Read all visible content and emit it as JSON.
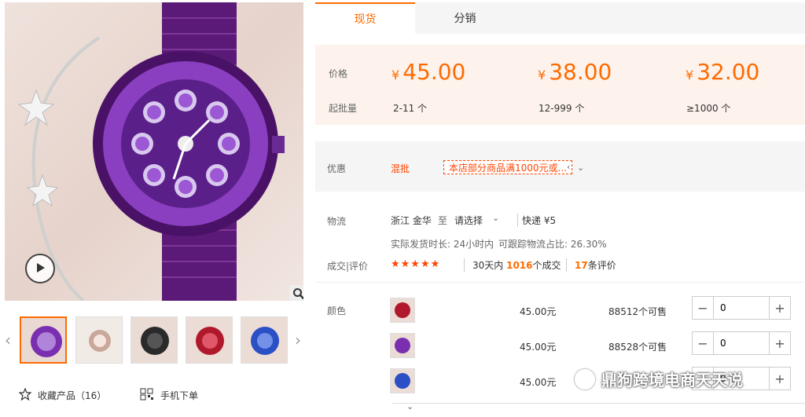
{
  "gallery": {
    "zoom_icon": "magnifier-icon",
    "play_icon": "play-icon",
    "prev_icon": "chevron-left-icon",
    "next_icon": "chevron-right-icon",
    "thumb_colors": [
      "#7a2fb0",
      "#c9a79b",
      "#2a2a2a",
      "#b0192c",
      "#2b4fc4"
    ]
  },
  "links": {
    "favorite_label": "收藏产品（16）",
    "mobile_label": "手机下单",
    "favorite_icon": "star-outline-icon",
    "mobile_icon": "qr-code-icon"
  },
  "tabs": [
    "现货",
    "分销"
  ],
  "pricing": {
    "price_label": "价格",
    "moq_label": "起批量",
    "currency": "¥",
    "tiers": [
      {
        "price": "45.00",
        "range": "2-11 个"
      },
      {
        "price": "38.00",
        "range": "12-999 个"
      },
      {
        "price": "32.00",
        "range": "≥1000 个"
      }
    ]
  },
  "promo": {
    "label": "优惠",
    "mixed": "混批",
    "tag": "本店部分商品满1000元或...",
    "tag_chevron": "chevron-left-icon",
    "expand_icon": "chevron-down-icon"
  },
  "logistics": {
    "label": "物流",
    "origin": "浙江 金华",
    "to": "至",
    "dest": "请选择",
    "shipping": "快递 ¥5",
    "dispatch": "实际发货时长: 24小时内",
    "trackable": "可跟踪物流占比: 26.30%"
  },
  "reviews": {
    "label": "成交|评价",
    "stars": "★★★★★",
    "deals_prefix": "30天内",
    "deals_count": "1016",
    "deals_suffix": "个成交",
    "review_count": "17",
    "review_suffix": "条评价"
  },
  "sku": {
    "label": "颜色",
    "items": [
      {
        "price": "45.00元",
        "stock": "88512个可售",
        "qty": "0",
        "color": "#b0192c"
      },
      {
        "price": "45.00元",
        "stock": "88528个可售",
        "qty": "0",
        "color": "#7a2fb0"
      },
      {
        "price": "45.00元",
        "stock": "",
        "qty": "0",
        "color": "#2b4fc4"
      }
    ]
  },
  "watermark": "鼎狗跨境电商天天说",
  "footer_chevron": "chevron-down-icon",
  "colors": {
    "accent": "#ff6a00",
    "promo": "#ff4400",
    "price_bg": "#fdf3ec"
  }
}
